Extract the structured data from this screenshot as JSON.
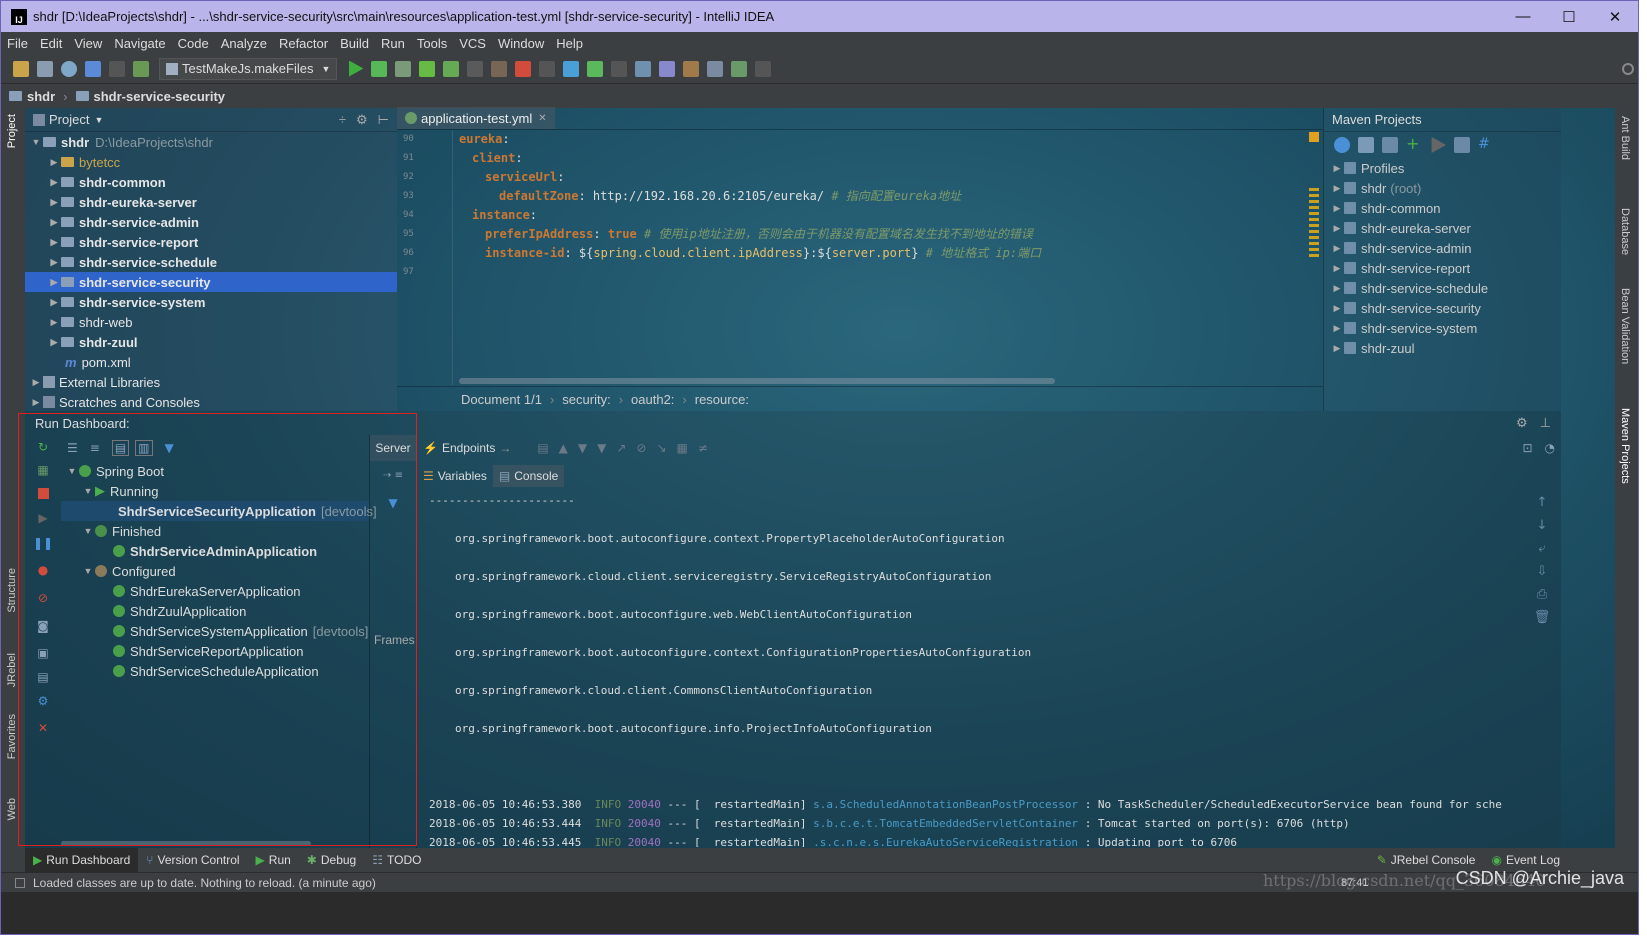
{
  "window": {
    "title": "shdr [D:\\IdeaProjects\\shdr] - ...\\shdr-service-security\\src\\main\\resources\\application-test.yml [shdr-service-security] - IntelliJ IDEA",
    "minimize": "—",
    "maximize": "☐",
    "close": "✕"
  },
  "menu": [
    "File",
    "Edit",
    "View",
    "Navigate",
    "Code",
    "Analyze",
    "Refactor",
    "Build",
    "Run",
    "Tools",
    "VCS",
    "Window",
    "Help"
  ],
  "toolbar": {
    "run_config": "TestMakeJs.makeFiles"
  },
  "nav": {
    "root": "shdr",
    "module": "shdr-service-security"
  },
  "project": {
    "header": "Project",
    "root_name": "shdr",
    "root_path": "D:\\IdeaProjects\\shdr",
    "items": [
      {
        "label": "bytetcc",
        "style": "excluded"
      },
      {
        "label": "shdr-common"
      },
      {
        "label": "shdr-eureka-server"
      },
      {
        "label": "shdr-service-admin"
      },
      {
        "label": "shdr-service-report"
      },
      {
        "label": "shdr-service-schedule"
      },
      {
        "label": "shdr-service-security",
        "selected": true
      },
      {
        "label": "shdr-service-system"
      },
      {
        "label": "shdr-web"
      },
      {
        "label": "shdr-zuul"
      }
    ],
    "pom": "pom.xml",
    "external": "External Libraries",
    "scratches": "Scratches and Consoles"
  },
  "editor": {
    "tab": "application-test.yml",
    "line_numbers": [
      "90",
      "91",
      "92",
      "93",
      "94",
      "95",
      "96",
      "97"
    ],
    "lines": [
      {
        "key": "eureka",
        "rest": ":"
      },
      {
        "key": "client",
        "rest": ":"
      },
      {
        "key": "serviceUrl",
        "rest": ":"
      },
      {
        "key": "defaultZone",
        "rest": ": http://192.168.20.6:2105/eureka/ ",
        "comment": "# 指向配置eureka地址"
      },
      {
        "key": "instance",
        "rest": ":"
      },
      {
        "key": "preferIpAddress",
        "rest": ": ",
        "value": "true",
        "comment": " # 使用ip地址注册，否则会由于机器没有配置域名发生找不到地址的错误"
      },
      {
        "key": "instance-id",
        "rest": ": ${",
        "value": "spring.cloud.client.ipAddress",
        "rest2": "}:${",
        "value2": "server.port",
        "rest3": "} ",
        "comment": "# 地址格式 ip:端口"
      },
      {
        "key": "",
        "rest": ""
      }
    ],
    "breadcrumb": [
      "Document 1/1",
      "security:",
      "oauth2:",
      "resource:"
    ]
  },
  "maven": {
    "header": "Maven Projects",
    "profiles": "Profiles",
    "root": "shdr",
    "root_tag": "(root)",
    "modules": [
      "shdr-common",
      "shdr-eureka-server",
      "shdr-service-admin",
      "shdr-service-report",
      "shdr-service-schedule",
      "shdr-service-security",
      "shdr-service-system",
      "shdr-zuul"
    ]
  },
  "run_dashboard": {
    "title": "Run Dashboard:",
    "spring_boot": "Spring Boot",
    "running": "Running",
    "running_app": "ShdrServiceSecurityApplication",
    "running_tag": "[devtools]",
    "finished": "Finished",
    "finished_app": "ShdrServiceAdminApplication",
    "configured": "Configured",
    "configured_apps": [
      {
        "name": "ShdrEurekaServerApplication",
        "tag": ""
      },
      {
        "name": "ShdrZuulApplication",
        "tag": ""
      },
      {
        "name": "ShdrServiceSystemApplication",
        "tag": "[devtools]"
      },
      {
        "name": "ShdrServiceReportApplication",
        "tag": ""
      },
      {
        "name": "ShdrServiceScheduleApplication",
        "tag": ""
      }
    ],
    "server_tab": "Server",
    "frames_label": "Frames",
    "endpoints_tab": "Endpoints",
    "variables_tab": "Variables",
    "console_tab": "Console"
  },
  "console": {
    "separator": "----------------------",
    "config_lines": [
      "org.springframework.boot.autoconfigure.context.PropertyPlaceholderAutoConfiguration",
      "org.springframework.cloud.client.serviceregistry.ServiceRegistryAutoConfiguration",
      "org.springframework.boot.autoconfigure.web.WebClientAutoConfiguration",
      "org.springframework.boot.autoconfigure.context.ConfigurationPropertiesAutoConfiguration",
      "org.springframework.cloud.client.CommonsClientAutoConfiguration",
      "org.springframework.boot.autoconfigure.info.ProjectInfoAutoConfiguration"
    ],
    "log_lines": [
      {
        "ts": "2018-06-05 10:46:53.380",
        "level": "INFO",
        "pid": "20040",
        "thread": "--- [  restartedMain]",
        "cls": "s.a.ScheduledAnnotationBeanPostProcessor",
        "msg": ": No TaskScheduler/ScheduledExecutorService bean found for sche"
      },
      {
        "ts": "2018-06-05 10:46:53.444",
        "level": "INFO",
        "pid": "20040",
        "thread": "--- [  restartedMain]",
        "cls": "s.b.c.e.t.TomcatEmbeddedServletContainer",
        "msg": ": Tomcat started on port(s): 6706 (http)"
      },
      {
        "ts": "2018-06-05 10:46:53.445",
        "level": "INFO",
        "pid": "20040",
        "thread": "--- [  restartedMain]",
        "cls": ".s.c.n.e.s.EurekaAutoServiceRegistration",
        "msg": ": Updating port to 6706"
      }
    ]
  },
  "bottom_tabs": [
    "Run Dashboard",
    "Version Control",
    "Run",
    "Debug",
    "TODO"
  ],
  "bottom_right": [
    "JRebel Console",
    "Event Log"
  ],
  "status": {
    "message": "Loaded classes are up to date. Nothing to reload. (a minute ago)",
    "position": "87:41"
  },
  "side_left": [
    "Project",
    "Structure",
    "JRebel",
    "Favorites",
    "Web"
  ],
  "side_right": [
    "Ant Build",
    "Database",
    "Bean Validation",
    "Maven Projects"
  ],
  "watermark": {
    "url": "https://blog.csdn.net/qq_36084640",
    "brand": "CSDN @Archie_java"
  },
  "colors": {
    "title_bg": "#b9b5ea",
    "selection": "#2f65ca",
    "keyword": "#cc7832",
    "highlight_box": "#e02020"
  }
}
